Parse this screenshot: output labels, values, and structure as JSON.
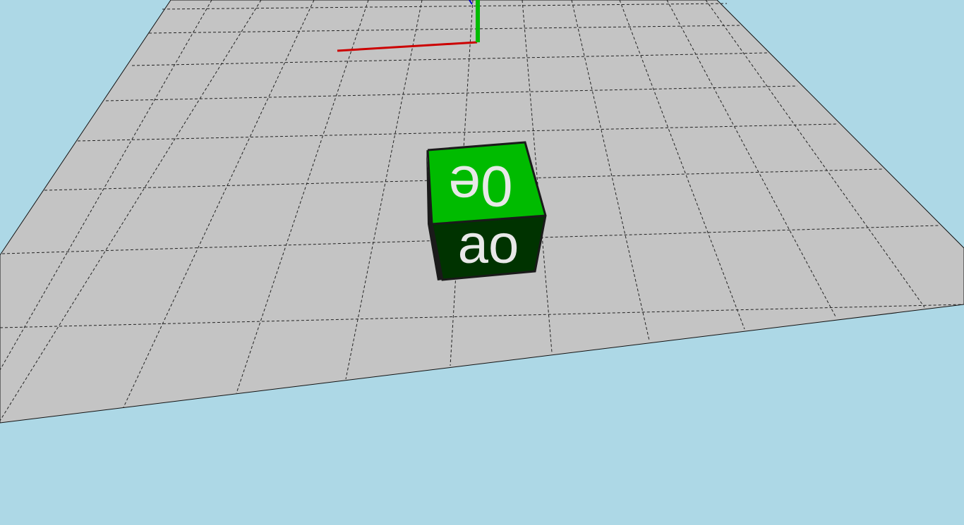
{
  "scene": {
    "background_color": "#add8e6",
    "ground": {
      "color": "#c4c4c4",
      "grid_line_color": "#222222",
      "grid_style": "dashed"
    },
    "axes": {
      "x_color": "#cc0000",
      "y_color": "#00bb00",
      "z_color": "#0000cc"
    },
    "cube": {
      "top_color": "#00bb00",
      "front_color": "#003300",
      "edge_color": "#1a1a1a",
      "text_color": "#e8e8e8",
      "top_label": "0e",
      "front_label": "ao"
    }
  }
}
